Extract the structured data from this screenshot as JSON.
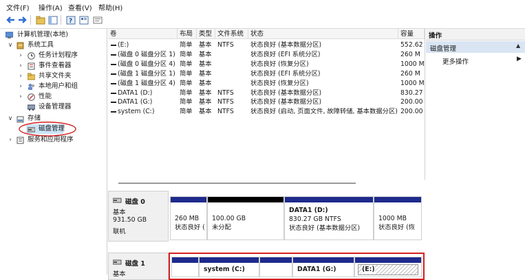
{
  "menu": [
    "文件(F)",
    "操作(A)",
    "查看(V)",
    "帮助(H)"
  ],
  "tree": {
    "root": "计算机管理(本地)",
    "system_tools": "系统工具",
    "task_scheduler": "任务计划程序",
    "event_viewer": "事件查看器",
    "shared_folders": "共享文件夹",
    "local_users": "本地用户和组",
    "performance": "性能",
    "device_manager": "设备管理器",
    "storage": "存储",
    "disk_management": "磁盘管理",
    "services_apps": "服务和应用程序"
  },
  "columns": [
    "卷",
    "布局",
    "类型",
    "文件系统",
    "状态",
    "容量"
  ],
  "volumes": [
    {
      "name": "(E:)",
      "layout": "简单",
      "type": "基本",
      "fs": "NTFS",
      "status": "状态良好 (基本数据分区)",
      "cap": "552.62"
    },
    {
      "name": "(磁盘 0 磁盘分区 1)",
      "layout": "简单",
      "type": "基本",
      "fs": "",
      "status": "状态良好 (EFI 系统分区)",
      "cap": "260 M"
    },
    {
      "name": "(磁盘 0 磁盘分区 4)",
      "layout": "简单",
      "type": "基本",
      "fs": "",
      "status": "状态良好 (恢复分区)",
      "cap": "1000 M"
    },
    {
      "name": "(磁盘 1 磁盘分区 1)",
      "layout": "简单",
      "type": "基本",
      "fs": "",
      "status": "状态良好 (EFI 系统分区)",
      "cap": "260 M"
    },
    {
      "name": "(磁盘 1 磁盘分区 4)",
      "layout": "简单",
      "type": "基本",
      "fs": "",
      "status": "状态良好 (恢复分区)",
      "cap": "1000 M"
    },
    {
      "name": "DATA1 (D:)",
      "layout": "简单",
      "type": "基本",
      "fs": "NTFS",
      "status": "状态良好 (基本数据分区)",
      "cap": "830.27"
    },
    {
      "name": "DATA1 (G:)",
      "layout": "简单",
      "type": "基本",
      "fs": "NTFS",
      "status": "状态良好 (基本数据分区)",
      "cap": "200.00"
    },
    {
      "name": "system (C:)",
      "layout": "简单",
      "type": "基本",
      "fs": "NTFS",
      "status": "状态良好 (启动, 页面文件, 故障转储, 基本数据分区)",
      "cap": "200.00"
    }
  ],
  "actions": {
    "header": "操作",
    "section": "磁盘管理",
    "more": "更多操作"
  },
  "disk0": {
    "label": "磁盘 0",
    "type": "基本",
    "size": "931.50 GB",
    "status": "联机",
    "parts": [
      {
        "line1": "",
        "line2": "260 MB",
        "line3": "状态良好 (",
        "color": "#1e2a8c"
      },
      {
        "line1": "",
        "line2": "100.00 GB",
        "line3": "未分配",
        "color": "#000000"
      },
      {
        "line1": "DATA1  (D:)",
        "line2": "830.27 GB NTFS",
        "line3": "状态良好 (基本数据分区)",
        "color": "#1e2a8c"
      },
      {
        "line1": "",
        "line2": "1000 MB",
        "line3": "状态良好 (恢",
        "color": "#1e2a8c"
      }
    ]
  },
  "disk1": {
    "label": "磁盘 1",
    "type": "基本",
    "parts": [
      {
        "line1": ""
      },
      {
        "line1": "system  (C:)"
      },
      {
        "line1": ""
      },
      {
        "line1": "DATA1  (G:)"
      },
      {
        "line1": "(E:)"
      }
    ]
  },
  "colors": {
    "primary_partition": "#1e2a8c",
    "unallocated": "#000000",
    "highlight": "#d62020",
    "selection": "#cce4f7",
    "action_header": "#d9e5f3"
  }
}
